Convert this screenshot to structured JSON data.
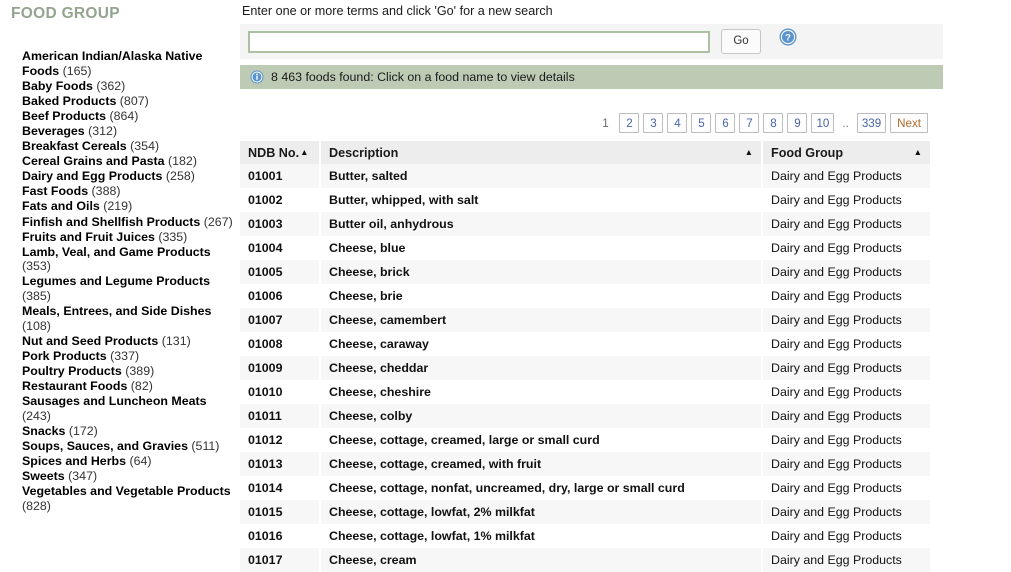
{
  "sidebar": {
    "title": "FOOD GROUP",
    "items": [
      {
        "name": "American Indian/Alaska Native Foods",
        "count": "(165)"
      },
      {
        "name": "Baby Foods",
        "count": "(362)"
      },
      {
        "name": "Baked Products",
        "count": "(807)"
      },
      {
        "name": "Beef Products",
        "count": "(864)"
      },
      {
        "name": "Beverages",
        "count": "(312)"
      },
      {
        "name": "Breakfast Cereals",
        "count": "(354)"
      },
      {
        "name": "Cereal Grains and Pasta",
        "count": "(182)"
      },
      {
        "name": "Dairy and Egg Products",
        "count": "(258)"
      },
      {
        "name": "Fast Foods",
        "count": "(388)"
      },
      {
        "name": "Fats and Oils",
        "count": "(219)"
      },
      {
        "name": "Finfish and Shellfish Products",
        "count": "(267)"
      },
      {
        "name": "Fruits and Fruit Juices",
        "count": "(335)"
      },
      {
        "name": "Lamb, Veal, and Game Products",
        "count": "(353)"
      },
      {
        "name": "Legumes and Legume Products",
        "count": "(385)"
      },
      {
        "name": "Meals, Entrees, and Side Dishes",
        "count": "(108)"
      },
      {
        "name": "Nut and Seed Products",
        "count": "(131)"
      },
      {
        "name": "Pork Products",
        "count": "(337)"
      },
      {
        "name": "Poultry Products",
        "count": "(389)"
      },
      {
        "name": "Restaurant Foods",
        "count": "(82)"
      },
      {
        "name": "Sausages and Luncheon Meats",
        "count": "(243)"
      },
      {
        "name": "Snacks",
        "count": "(172)"
      },
      {
        "name": "Soups, Sauces, and Gravies",
        "count": "(511)"
      },
      {
        "name": "Spices and Herbs",
        "count": "(64)"
      },
      {
        "name": "Sweets",
        "count": "(347)"
      },
      {
        "name": "Vegetables and Vegetable Products",
        "count": "(828)"
      }
    ]
  },
  "search": {
    "prompt": "Enter one or more terms and click 'Go' for a new search",
    "value": "",
    "placeholder": "",
    "go_label": "Go",
    "help_icon": "help-circle-icon"
  },
  "info": {
    "icon": "info-circle-icon",
    "message": "8 463 foods found:  Click on a food name to view details"
  },
  "pagination": {
    "current": "1",
    "pages": [
      "2",
      "3",
      "4",
      "5",
      "6",
      "7",
      "8",
      "9",
      "10"
    ],
    "ellipsis": "..",
    "last": "339",
    "next_label": "Next"
  },
  "table": {
    "columns": [
      {
        "label": "NDB No.",
        "sort": "▲"
      },
      {
        "label": "Description",
        "sort": "▲"
      },
      {
        "label": "Food Group",
        "sort": "▲"
      }
    ],
    "rows": [
      {
        "ndb": "01001",
        "desc": "Butter, salted",
        "group": "Dairy and Egg Products"
      },
      {
        "ndb": "01002",
        "desc": "Butter, whipped, with salt",
        "group": "Dairy and Egg Products"
      },
      {
        "ndb": "01003",
        "desc": "Butter oil, anhydrous",
        "group": "Dairy and Egg Products"
      },
      {
        "ndb": "01004",
        "desc": "Cheese, blue",
        "group": "Dairy and Egg Products"
      },
      {
        "ndb": "01005",
        "desc": "Cheese, brick",
        "group": "Dairy and Egg Products"
      },
      {
        "ndb": "01006",
        "desc": "Cheese, brie",
        "group": "Dairy and Egg Products"
      },
      {
        "ndb": "01007",
        "desc": "Cheese, camembert",
        "group": "Dairy and Egg Products"
      },
      {
        "ndb": "01008",
        "desc": "Cheese, caraway",
        "group": "Dairy and Egg Products"
      },
      {
        "ndb": "01009",
        "desc": "Cheese, cheddar",
        "group": "Dairy and Egg Products"
      },
      {
        "ndb": "01010",
        "desc": "Cheese, cheshire",
        "group": "Dairy and Egg Products"
      },
      {
        "ndb": "01011",
        "desc": "Cheese, colby",
        "group": "Dairy and Egg Products"
      },
      {
        "ndb": "01012",
        "desc": "Cheese, cottage, creamed, large or small curd",
        "group": "Dairy and Egg Products"
      },
      {
        "ndb": "01013",
        "desc": "Cheese, cottage, creamed, with fruit",
        "group": "Dairy and Egg Products"
      },
      {
        "ndb": "01014",
        "desc": "Cheese, cottage, nonfat, uncreamed, dry, large or small curd",
        "group": "Dairy and Egg Products"
      },
      {
        "ndb": "01015",
        "desc": "Cheese, cottage, lowfat, 2% milkfat",
        "group": "Dairy and Egg Products"
      },
      {
        "ndb": "01016",
        "desc": "Cheese, cottage, lowfat, 1% milkfat",
        "group": "Dairy and Egg Products"
      },
      {
        "ndb": "01017",
        "desc": "Cheese, cream",
        "group": "Dairy and Egg Products"
      }
    ]
  },
  "colors": {
    "sidebar_heading": "#93a48f",
    "banner_bg": "#bdcbb4",
    "input_border": "#acc0a3",
    "link": "#4a66a8",
    "next_link": "#b06a2c",
    "header_bg": "#ededed",
    "row_alt_bg": "#f7f7f7"
  }
}
